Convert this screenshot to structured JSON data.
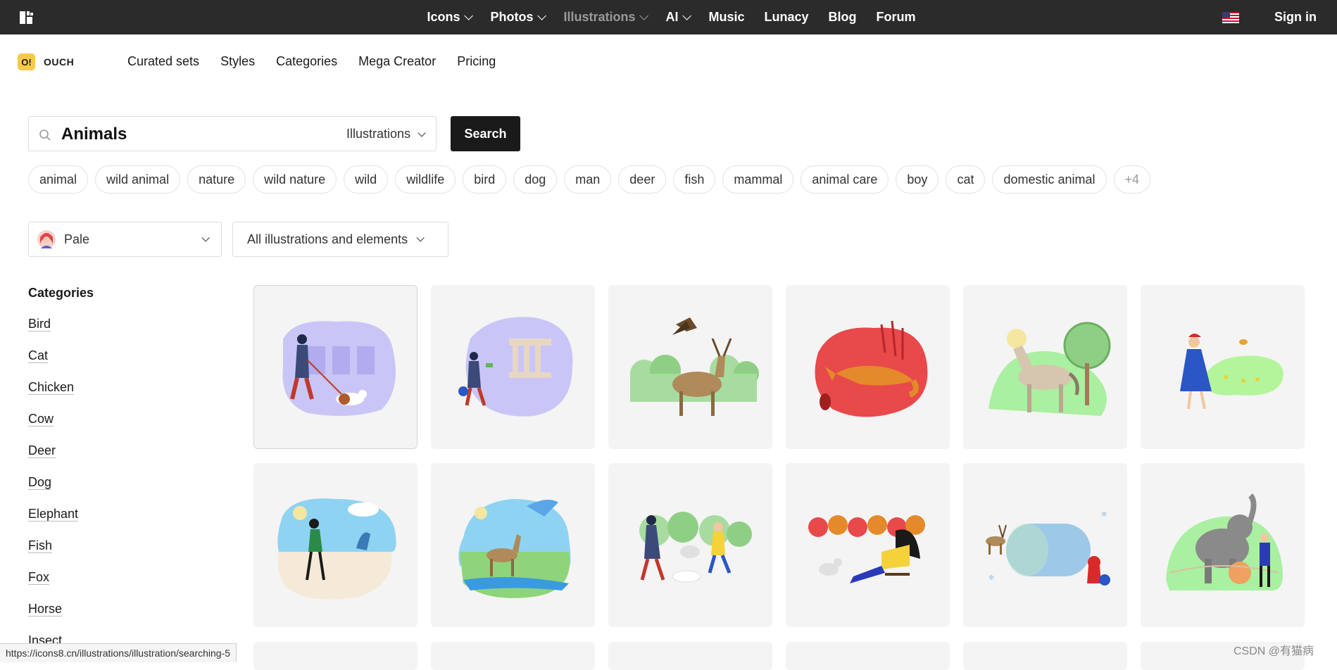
{
  "topbar": {
    "nav": [
      {
        "label": "Icons",
        "dropdown": true,
        "dim": false
      },
      {
        "label": "Photos",
        "dropdown": true,
        "dim": false
      },
      {
        "label": "Illustrations",
        "dropdown": true,
        "dim": true
      },
      {
        "label": "AI",
        "dropdown": true,
        "dim": false
      },
      {
        "label": "Music",
        "dropdown": false,
        "dim": false
      },
      {
        "label": "Lunacy",
        "dropdown": false,
        "dim": false
      },
      {
        "label": "Blog",
        "dropdown": false,
        "dim": false
      },
      {
        "label": "Forum",
        "dropdown": false,
        "dim": false
      }
    ],
    "signin": "Sign in",
    "flag_icon": "us-flag-icon"
  },
  "brand": {
    "badge": "O!",
    "name": "OUCH"
  },
  "subnav": [
    "Curated sets",
    "Styles",
    "Categories",
    "Mega Creator",
    "Pricing"
  ],
  "search": {
    "value": "Animals",
    "type": "Illustrations",
    "button": "Search"
  },
  "tags": [
    "animal",
    "wild animal",
    "nature",
    "wild nature",
    "wild",
    "wildlife",
    "bird",
    "dog",
    "man",
    "deer",
    "fish",
    "mammal",
    "animal care",
    "boy",
    "cat",
    "domestic animal",
    "+4"
  ],
  "filters": {
    "skin": "Pale",
    "type": "All illustrations and elements"
  },
  "categories": {
    "title": "Categories",
    "items": [
      "Bird",
      "Cat",
      "Chicken",
      "Cow",
      "Deer",
      "Dog",
      "Elephant",
      "Fish",
      "Fox",
      "Horse",
      "Insect"
    ]
  },
  "illustrations": [
    {
      "name": "man-walking-dog",
      "bg": "#c9c6f7"
    },
    {
      "name": "man-at-museum",
      "bg": "#c9c6f7"
    },
    {
      "name": "deer-and-eagle",
      "bg": "#a8dba0"
    },
    {
      "name": "fox-autumn",
      "bg": "#e8494a"
    },
    {
      "name": "horse-in-meadow",
      "bg": "#a9f0a0"
    },
    {
      "name": "woman-with-bees",
      "bg": "#b4f59c"
    },
    {
      "name": "woman-on-beach",
      "bg": "#8fd3f2"
    },
    {
      "name": "deer-and-bird",
      "bg": "#8fd3f2"
    },
    {
      "name": "people-walking-dogs",
      "bg": "#a8dba0"
    },
    {
      "name": "woman-with-dog-autumn",
      "bg": "#e8494a"
    },
    {
      "name": "deer-winter-banner",
      "bg": "#9ec8e8"
    },
    {
      "name": "elephant-circus",
      "bg": "#a9f0a0"
    }
  ],
  "status_url": "https://icons8.cn/illustrations/illustration/searching-5",
  "watermark": "CSDN @有猫病"
}
